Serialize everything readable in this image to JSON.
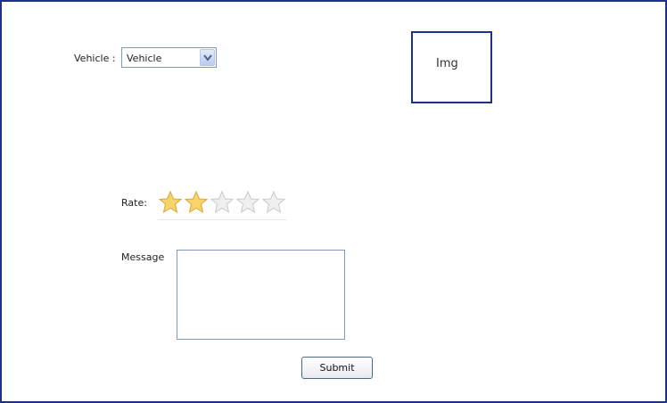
{
  "form": {
    "vehicle_label": "Vehicle :",
    "vehicle_selected": "Vehicle",
    "image_placeholder": "Img",
    "rate_label": "Rate:",
    "rating": {
      "value": 2,
      "max": 5
    },
    "message_label": "Message",
    "message_value": "",
    "submit_label": "Submit"
  },
  "colors": {
    "border_accent": "#1c3188",
    "star_filled": "#f7d36b",
    "star_empty": "#efefef"
  }
}
